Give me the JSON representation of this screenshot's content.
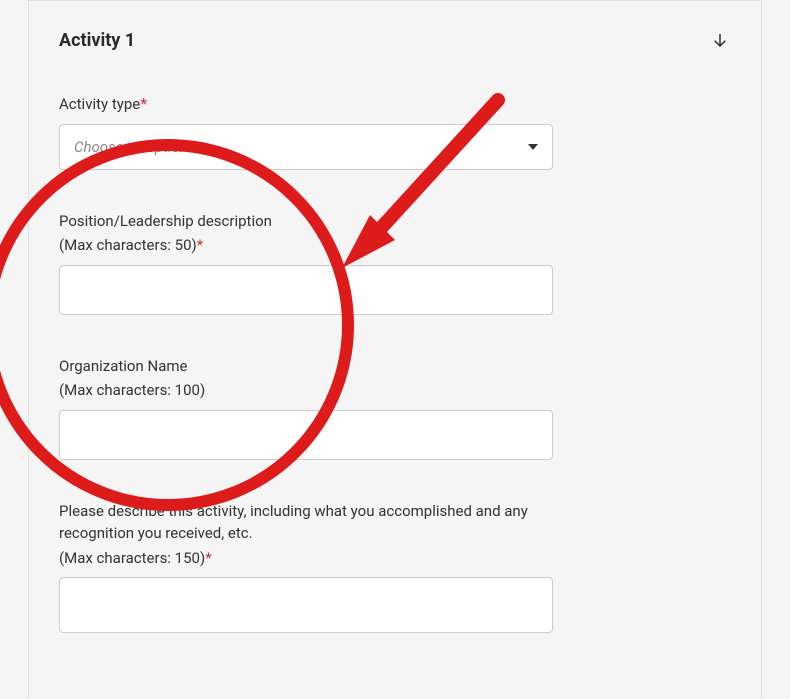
{
  "section": {
    "title": "Activity 1"
  },
  "fields": {
    "activity_type": {
      "label": "Activity type",
      "required_marker": "*",
      "placeholder": "Choose an option"
    },
    "position": {
      "label": "Position/Leadership description",
      "sublabel": "(Max characters: 50)",
      "required_marker": "*",
      "value": ""
    },
    "organization": {
      "label": "Organization Name",
      "sublabel": "(Max characters: 100)",
      "value": ""
    },
    "description": {
      "label": "Please describe this activity, including what you accomplished and any recognition you received, etc.",
      "sublabel": "(Max characters: 150)",
      "required_marker": "*",
      "value": ""
    }
  },
  "annotation": {
    "circle_color": "#de1b1b",
    "arrow_color": "#de1b1b"
  }
}
